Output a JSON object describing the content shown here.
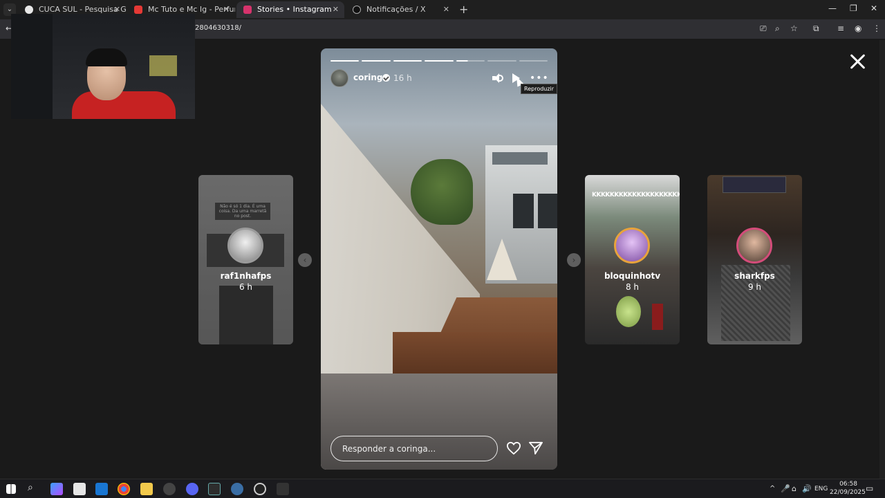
{
  "browser": {
    "tabs": [
      {
        "title": "CUCA SUL - Pesquisa Google",
        "favicon_color": "#e8e8e8",
        "active": false
      },
      {
        "title": "Mc Tuto e Mc Ig - Perfume Exal",
        "favicon_color": "#e53935",
        "active": false
      },
      {
        "title": "Stories • Instagram",
        "favicon_color": "#d6336c",
        "active": true
      },
      {
        "title": "Notificações / X",
        "favicon_color": "#111111",
        "active": false
      }
    ],
    "new_tab_label": "+",
    "url": "2804630318/"
  },
  "story": {
    "username": "coringa",
    "time": "16 h",
    "tooltip": "Reproduzir",
    "reply_placeholder": "Responder a coringa...",
    "progress": [
      1,
      1,
      1,
      1,
      0.4,
      0,
      0
    ]
  },
  "side_stories": [
    {
      "username": "raf1nhafps",
      "time": "6 h",
      "caption": "Não é só 1 dia. É uma coisa. Da uma marretã no post."
    },
    {
      "username": "bloquinhotv",
      "time": "8 h",
      "caption": "KKKKKKKKKKKKKKKKKKKK"
    },
    {
      "username": "sharkfps",
      "time": "9 h"
    }
  ],
  "taskbar": {
    "language": "ENG",
    "time": "06:58",
    "date": "22/09/2025"
  },
  "colors": {
    "page_bg": "#1a1a1a",
    "chrome_bg": "#1f1f1f",
    "active_tab_bg": "#2f2f33"
  }
}
